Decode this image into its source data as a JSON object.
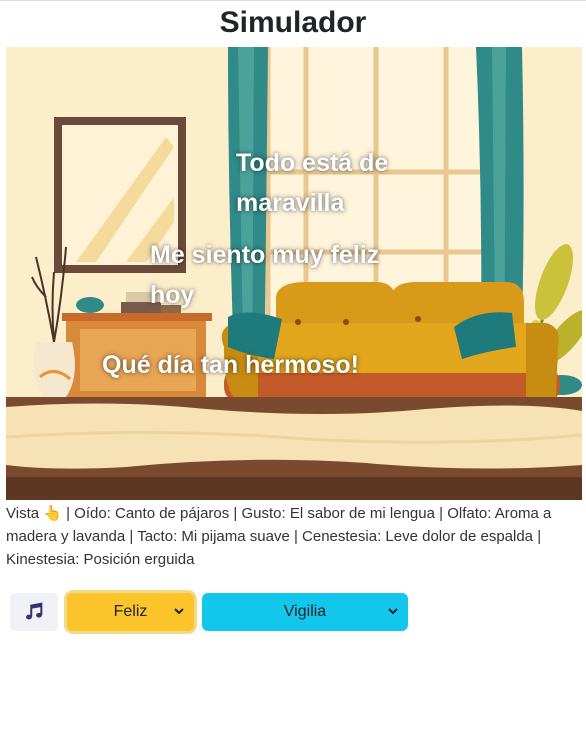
{
  "page": {
    "title": "Simulador"
  },
  "thoughts": [
    "Todo está de maravilla",
    "Me siento muy feliz hoy",
    "Qué día tan hermoso!"
  ],
  "senses": {
    "vista": "Vista 👆",
    "oido": "Oído: Canto de pájaros",
    "gusto": "Gusto: El sabor de mi lengua",
    "olfato": "Olfato: Aroma a madera y lavanda",
    "tacto": "Tacto: Mi pijama suave",
    "cenestesia": "Cenestesia: Leve dolor de espalda",
    "kinestesia": "Kinestesia: Posición erguida",
    "separator": " | "
  },
  "controls": {
    "music_icon": "music-note-icon",
    "mood": {
      "selected": "Feliz",
      "color": "#fcc42b"
    },
    "state": {
      "selected": "Vigilia",
      "color": "#12c6ec"
    }
  }
}
